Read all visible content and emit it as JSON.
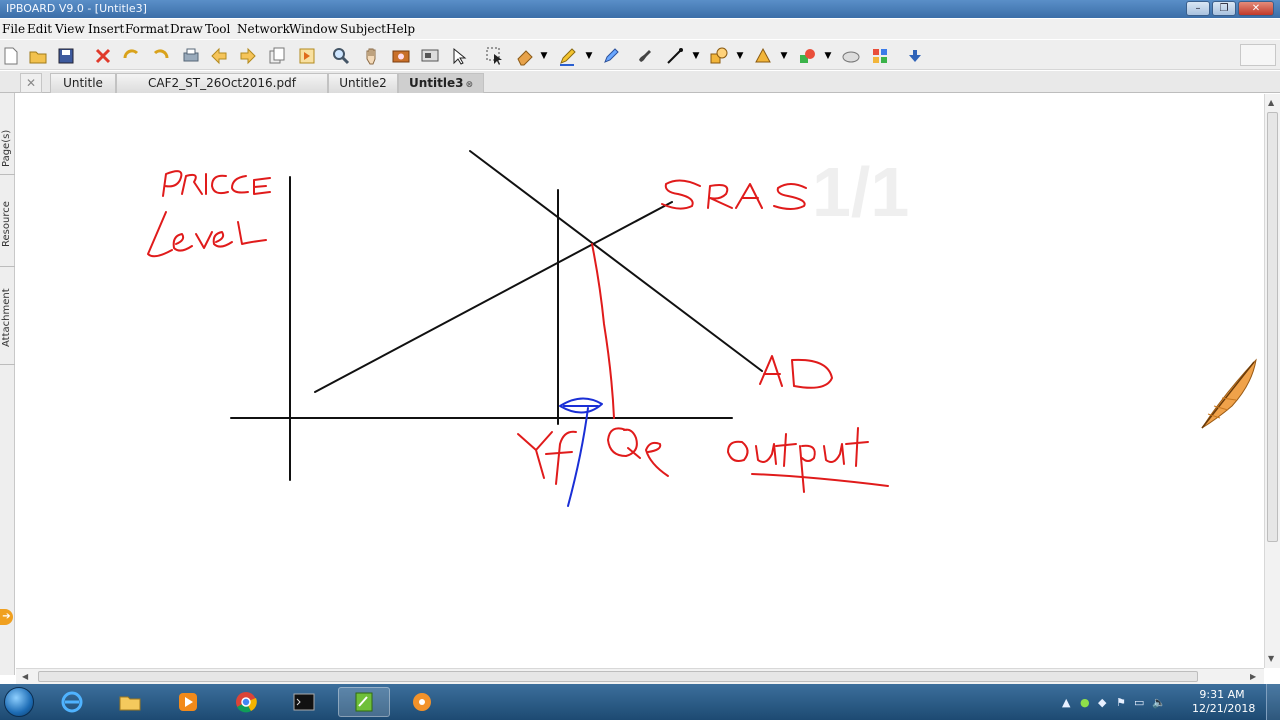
{
  "window": {
    "title": "IPBOARD V9.0 - [Untitle3]"
  },
  "menu": [
    "File",
    "Edit",
    "View",
    "Insert",
    "Format",
    "Draw",
    "Tool",
    "Network",
    "Window",
    "Subject",
    "Help"
  ],
  "tabs": {
    "close_all": "✕",
    "items": [
      {
        "label": "Untitle",
        "active": false
      },
      {
        "label": "CAF2_ST_26Oct2016.pdf",
        "active": false
      },
      {
        "label": "Untitle2",
        "active": false
      },
      {
        "label": "Untitle3",
        "active": true
      }
    ],
    "close_glyph": "⊗"
  },
  "sidebar": {
    "tabs": [
      "Page(s)",
      "Resource",
      "Attachment"
    ]
  },
  "canvas": {
    "page_number": "1/1",
    "annotations": {
      "y_axis": "PRICE Level",
      "sras": "SRAS",
      "ad": "AD",
      "yf": "Yf",
      "qe": "Qe",
      "x_axis": "output"
    },
    "ink_colors": {
      "black": "#111111",
      "red": "#e01b1b",
      "blue": "#1a2fd6"
    }
  },
  "taskbar": {
    "apps": [
      "internet-explorer",
      "file-explorer",
      "media-player",
      "chrome",
      "command-prompt",
      "ipboard",
      "paint"
    ],
    "clock": {
      "time": "9:31 AM",
      "date": "12/21/2018"
    }
  }
}
